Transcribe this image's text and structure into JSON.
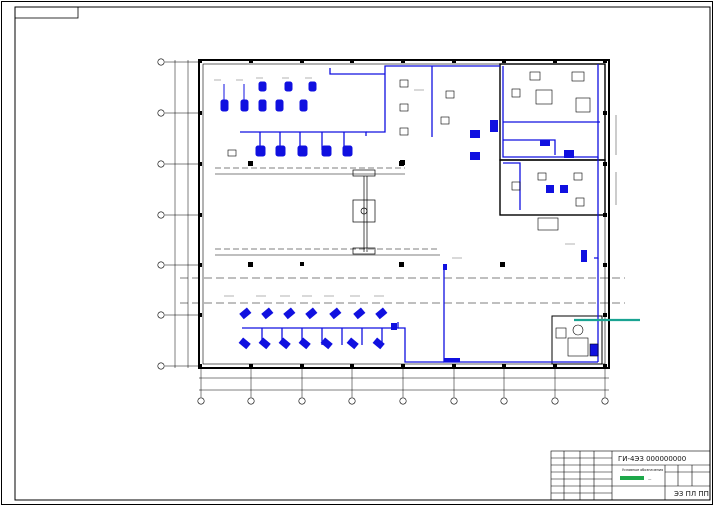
{
  "drawing": {
    "title_block": {
      "code": "ГИ-4ЭЗ 000000000",
      "sheet_caption": "ЭЗ ПЛ ПП",
      "legend_caption": "Условные обозначения",
      "legend_item": "—"
    }
  },
  "colors": {
    "frame": "#000000",
    "wall": "#000000",
    "cable_route": "#1010e0",
    "highlight_route": "#1aa392",
    "legend_fill": "#1ea84a",
    "stroke": "#222222"
  },
  "icons": {
    "column_marker": "circle-axis-marker",
    "machine_symbol": "machine-icon",
    "cabinet_symbol": "cabinet-icon"
  }
}
